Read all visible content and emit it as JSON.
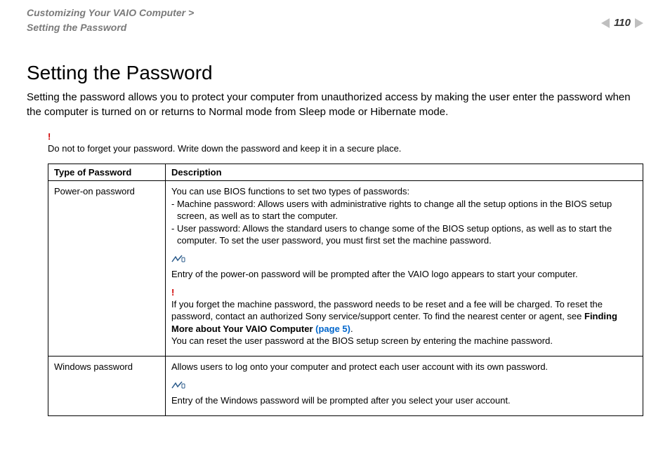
{
  "header": {
    "breadcrumb_line1": "Customizing Your VAIO Computer >",
    "breadcrumb_line2": "Setting the Password",
    "page_number": "110"
  },
  "title": "Setting the Password",
  "intro": "Setting the password allows you to protect your computer from unauthorized access by making the user enter the password when the computer is turned on or returns to Normal mode from Sleep mode or Hibernate mode.",
  "top_warning": {
    "mark": "!",
    "text": "Do not to forget your password. Write down the password and keep it in a secure place."
  },
  "table": {
    "th_type": "Type of Password",
    "th_desc": "Description",
    "rows": [
      {
        "type": "Power-on password",
        "lead": "You can use BIOS functions to set two types of passwords:",
        "bullet1_prefix": "- Machine password: Allows users with administrative rights to change all the setup options in the BIOS setup",
        "bullet1_cont": "screen, as well as to start the computer.",
        "bullet2_prefix": "- User password: Allows the standard users to change some of the BIOS setup options, as well as to start the",
        "bullet2_cont": "computer. To set the user password, you must first set the machine password.",
        "note1": "Entry of the power-on password will be prompted after the VAIO logo appears to start your computer.",
        "warn_mark": "!",
        "warn_line1": "If you forget the machine password, the password needs to be reset and a fee will be charged. To reset the password, contact an authorized Sony service/support center. To find the nearest center or agent, see ",
        "warn_bold": "Finding More about Your VAIO Computer ",
        "warn_link": "(page 5)",
        "warn_period": ".",
        "warn_line2": "You can reset the user password at the BIOS setup screen by entering the machine password."
      },
      {
        "type": "Windows password",
        "lead": "Allows users to log onto your computer and protect each user account with its own password.",
        "note1": "Entry of the Windows password will be prompted after you select your user account."
      }
    ]
  }
}
